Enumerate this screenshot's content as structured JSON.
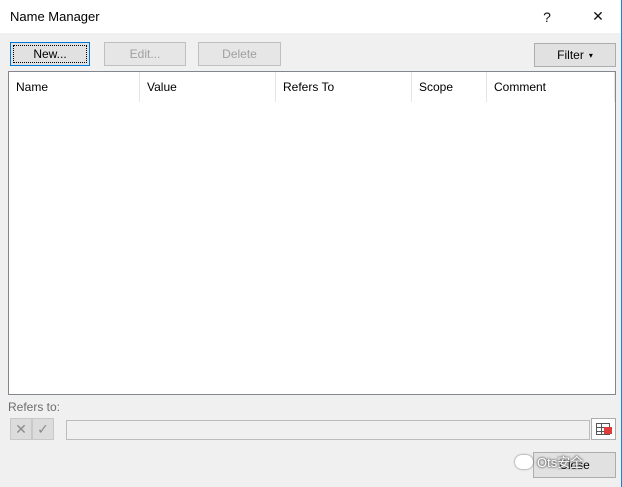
{
  "window": {
    "title": "Name Manager",
    "help_label": "?",
    "close_glyph": "✕"
  },
  "toolbar": {
    "new_label": "New...",
    "edit_label": "Edit...",
    "delete_label": "Delete",
    "filter_label": "Filter",
    "filter_arrow": "▾"
  },
  "table": {
    "columns": [
      "Name",
      "Value",
      "Refers To",
      "Scope",
      "Comment"
    ],
    "rows": []
  },
  "refers": {
    "label": "Refers to:",
    "value": "",
    "cancel_glyph": "✕",
    "ok_glyph": "✓"
  },
  "footer": {
    "close_label": "Close"
  },
  "watermark": {
    "text": "Ots安全"
  },
  "colors": {
    "accent": "#0078d7",
    "window_border": "#1883d7",
    "dialog_bg": "#f0f0f0"
  },
  "icons": [
    "help-icon",
    "close-icon",
    "dropdown-arrow-icon",
    "cancel-x-icon",
    "check-icon",
    "collapse-dialog-icon",
    "wechat-icon"
  ]
}
